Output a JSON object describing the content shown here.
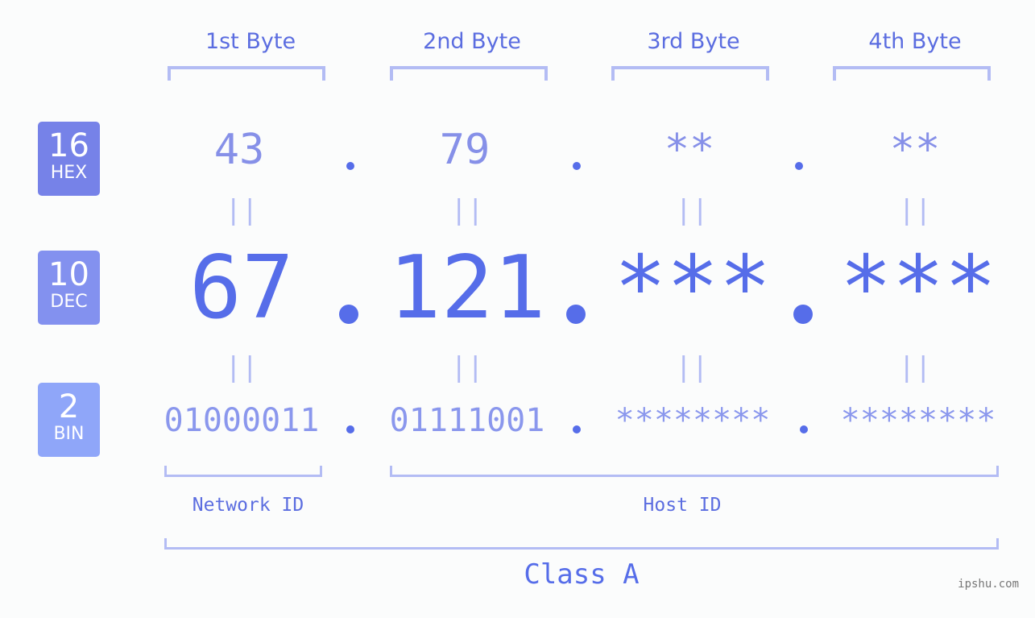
{
  "headers": [
    "1st Byte",
    "2nd Byte",
    "3rd Byte",
    "4th Byte"
  ],
  "bases": [
    {
      "number": "16",
      "label": "HEX",
      "color": "#7682e8"
    },
    {
      "number": "10",
      "label": "DEC",
      "color": "#8391ef"
    },
    {
      "number": "2",
      "label": "BIN",
      "color": "#8fa6f9"
    }
  ],
  "hex": [
    "43",
    "79",
    "**",
    "**"
  ],
  "dec": [
    "67",
    "121",
    "***",
    "***"
  ],
  "bin": [
    "01000011",
    "01111001",
    "********",
    "********"
  ],
  "equals_glyph": "||",
  "network_id_label": "Network ID",
  "host_id_label": "Host ID",
  "class_label": "Class A",
  "watermark": "ipshu.com",
  "colors": {
    "accent": "#566de9",
    "bracket": "#b3bcf4",
    "background": "#fbfcfc"
  }
}
